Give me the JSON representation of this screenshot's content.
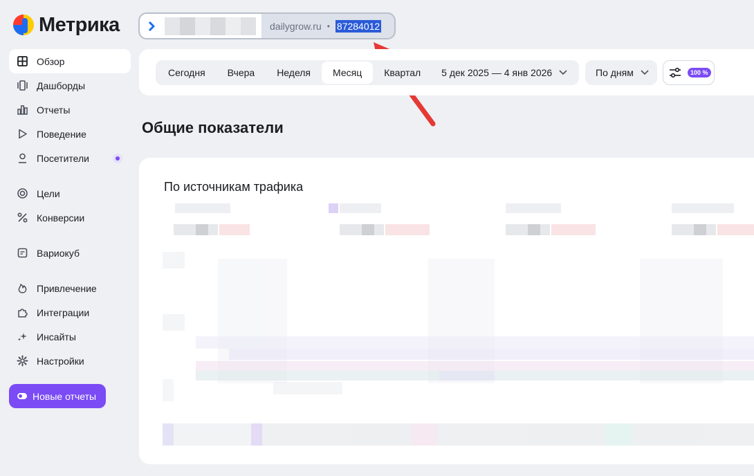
{
  "logo": {
    "text": "Метрика"
  },
  "counter": {
    "domain": "dailygrow.ru",
    "separator": "•",
    "id": "87284012"
  },
  "sidebar": {
    "items": [
      {
        "label": "Обзор",
        "icon": "grid-icon",
        "active": true
      },
      {
        "label": "Дашборды",
        "icon": "dashboards-icon"
      },
      {
        "label": "Отчеты",
        "icon": "reports-icon"
      },
      {
        "label": "Поведение",
        "icon": "play-icon"
      },
      {
        "label": "Посетители",
        "icon": "user-icon",
        "badge": true
      },
      {
        "label": "Цели",
        "icon": "target-icon"
      },
      {
        "label": "Конверсии",
        "icon": "percent-icon"
      },
      {
        "label": "Вариокуб",
        "icon": "variocube-icon"
      },
      {
        "label": "Привлечение",
        "icon": "flame-icon"
      },
      {
        "label": "Интеграции",
        "icon": "puzzle-icon"
      },
      {
        "label": "Инсайты",
        "icon": "sparkle-icon"
      },
      {
        "label": "Настройки",
        "icon": "gear-icon"
      }
    ],
    "new_reports_button": "Новые отчеты"
  },
  "filters": {
    "periods": [
      "Сегодня",
      "Вчера",
      "Неделя",
      "Месяц",
      "Квартал"
    ],
    "active_period": "Месяц",
    "date_range": "5 дек 2025 — 4 янв 2026",
    "grouping": "По дням",
    "sample_badge": "100 %"
  },
  "section_title": "Общие показатели",
  "card_title": "По источникам трафика",
  "colors": {
    "accent": "#7b4bf5",
    "selection": "#2a5bd7",
    "annotation": "#e53935",
    "background": "#eef0f4"
  }
}
